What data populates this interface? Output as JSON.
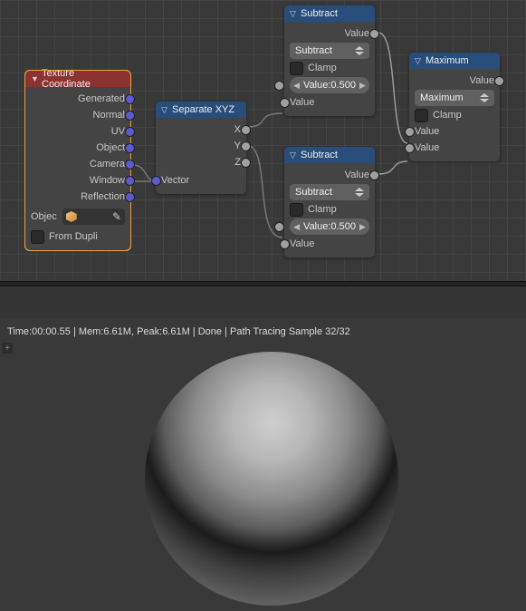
{
  "nodes": {
    "texcoord": {
      "title": "Texture Coordinate",
      "outputs": [
        "Generated",
        "Normal",
        "UV",
        "Object",
        "Camera",
        "Window",
        "Reflection"
      ],
      "object_label": "Objec",
      "from_dupli": "From Dupli"
    },
    "sepxyz": {
      "title": "Separate XYZ",
      "outputs": [
        "X",
        "Y",
        "Z"
      ],
      "input": "Vector"
    },
    "sub1": {
      "title": "Subtract",
      "out": "Value",
      "op": "Subtract",
      "clamp": "Clamp",
      "num_label": "Value:",
      "num_value": "0.500",
      "in2": "Value"
    },
    "sub2": {
      "title": "Subtract",
      "out": "Value",
      "op": "Subtract",
      "clamp": "Clamp",
      "num_label": "Value:",
      "num_value": "0.500",
      "in2": "Value"
    },
    "max": {
      "title": "Maximum",
      "out": "Value",
      "op": "Maximum",
      "clamp": "Clamp",
      "in1": "Value",
      "in2": "Value"
    }
  },
  "status": "Time:00:00.55 | Mem:6.61M, Peak:6.61M | Done | Path Tracing Sample 32/32"
}
